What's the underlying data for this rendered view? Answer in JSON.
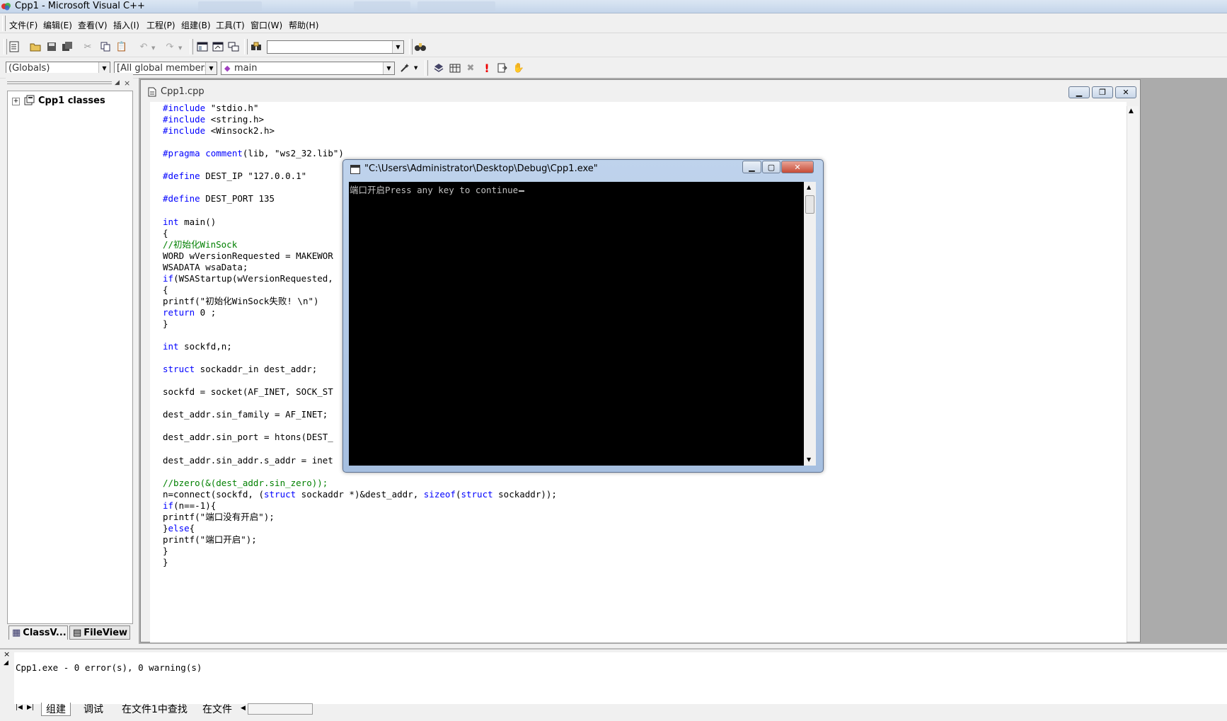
{
  "window": {
    "title": "Cpp1 - Microsoft Visual C++"
  },
  "menu": [
    {
      "label": "文件(F)"
    },
    {
      "label": "编辑(E)"
    },
    {
      "label": "查看(V)"
    },
    {
      "label": "插入(I)"
    },
    {
      "label": "工程(P)"
    },
    {
      "label": "组建(B)"
    },
    {
      "label": "工具(T)"
    },
    {
      "label": "窗口(W)"
    },
    {
      "label": "帮助(H)"
    }
  ],
  "wizardbar": {
    "scope": "(Globals)",
    "filter": "[All global members",
    "member": "main"
  },
  "workspace": {
    "tree_root": "Cpp1 classes",
    "tabs": [
      {
        "label": "ClassV..."
      },
      {
        "label": "FileView"
      }
    ]
  },
  "editor": {
    "title": "Cpp1.cpp",
    "lines": [
      {
        "tokens": [
          {
            "t": "#include",
            "c": "kw"
          },
          {
            "t": " \"stdio.h\""
          }
        ]
      },
      {
        "tokens": [
          {
            "t": "#include",
            "c": "kw"
          },
          {
            "t": " <string.h>"
          }
        ]
      },
      {
        "tokens": [
          {
            "t": "#include",
            "c": "kw"
          },
          {
            "t": " <Winsock2.h>"
          }
        ]
      },
      {
        "tokens": []
      },
      {
        "tokens": [
          {
            "t": "#pragma",
            "c": "kw"
          },
          {
            "t": " "
          },
          {
            "t": "comment",
            "c": "kw"
          },
          {
            "t": "(lib, \"ws2_32.lib\")"
          }
        ]
      },
      {
        "tokens": []
      },
      {
        "tokens": [
          {
            "t": "#define",
            "c": "kw"
          },
          {
            "t": " DEST_IP \"127.0.0.1\""
          }
        ]
      },
      {
        "tokens": []
      },
      {
        "tokens": [
          {
            "t": "#define",
            "c": "kw"
          },
          {
            "t": " DEST_PORT 135"
          }
        ]
      },
      {
        "tokens": []
      },
      {
        "tokens": [
          {
            "t": "int",
            "c": "kw"
          },
          {
            "t": " main()"
          }
        ]
      },
      {
        "tokens": [
          {
            "t": "{"
          }
        ]
      },
      {
        "tokens": [
          {
            "t": "//初始化WinSock",
            "c": "cm"
          }
        ]
      },
      {
        "tokens": [
          {
            "t": "WORD wVersionRequested = MAKEWOR"
          }
        ]
      },
      {
        "tokens": [
          {
            "t": "WSADATA wsaData;"
          }
        ]
      },
      {
        "tokens": [
          {
            "t": "if",
            "c": "kw"
          },
          {
            "t": "(WSAStartup(wVersionRequested,"
          }
        ]
      },
      {
        "tokens": [
          {
            "t": "{"
          }
        ]
      },
      {
        "tokens": [
          {
            "t": "printf(\"初始化WinSock失败! \\n\")"
          }
        ]
      },
      {
        "tokens": [
          {
            "t": "return",
            "c": "kw"
          },
          {
            "t": " 0 ;"
          }
        ]
      },
      {
        "tokens": [
          {
            "t": "}"
          }
        ]
      },
      {
        "tokens": []
      },
      {
        "tokens": [
          {
            "t": "int",
            "c": "kw"
          },
          {
            "t": " sockfd,n;"
          }
        ]
      },
      {
        "tokens": []
      },
      {
        "tokens": [
          {
            "t": "struct",
            "c": "kw"
          },
          {
            "t": " sockaddr_in dest_addr;"
          }
        ]
      },
      {
        "tokens": []
      },
      {
        "tokens": [
          {
            "t": "sockfd = socket(AF_INET, SOCK_ST"
          }
        ]
      },
      {
        "tokens": []
      },
      {
        "tokens": [
          {
            "t": "dest_addr.sin_family = AF_INET;"
          }
        ]
      },
      {
        "tokens": []
      },
      {
        "tokens": [
          {
            "t": "dest_addr.sin_port = htons(DEST_"
          }
        ]
      },
      {
        "tokens": []
      },
      {
        "tokens": [
          {
            "t": "dest_addr.sin_addr.s_addr = inet"
          }
        ]
      },
      {
        "tokens": []
      },
      {
        "tokens": [
          {
            "t": "//bzero(&(dest_addr.sin_zero));",
            "c": "cm"
          }
        ]
      },
      {
        "tokens": [
          {
            "t": "n=connect(sockfd, ("
          },
          {
            "t": "struct",
            "c": "kw"
          },
          {
            "t": " sockaddr *)&dest_addr, "
          },
          {
            "t": "sizeof",
            "c": "kw"
          },
          {
            "t": "("
          },
          {
            "t": "struct",
            "c": "kw"
          },
          {
            "t": " sockaddr));"
          }
        ]
      },
      {
        "tokens": [
          {
            "t": "if",
            "c": "kw"
          },
          {
            "t": "(n==-1){"
          }
        ]
      },
      {
        "tokens": [
          {
            "t": "printf(\"端口没有开启\");"
          }
        ]
      },
      {
        "tokens": [
          {
            "t": "}"
          },
          {
            "t": "else",
            "c": "kw"
          },
          {
            "t": "{"
          }
        ]
      },
      {
        "tokens": [
          {
            "t": "printf(\"端口开启\");"
          }
        ]
      },
      {
        "tokens": [
          {
            "t": "}"
          }
        ]
      },
      {
        "tokens": [
          {
            "t": "}"
          }
        ]
      }
    ]
  },
  "console": {
    "title": "\"C:\\Users\\Administrator\\Desktop\\Debug\\Cpp1.exe\"",
    "output": "端口开启Press any key to continue"
  },
  "output": {
    "text": "Cpp1.exe - 0 error(s), 0 warning(s)",
    "tabs": [
      {
        "label": "组建"
      },
      {
        "label": "调试"
      },
      {
        "label": "在文件1中查找"
      },
      {
        "label": "在文件"
      }
    ]
  }
}
